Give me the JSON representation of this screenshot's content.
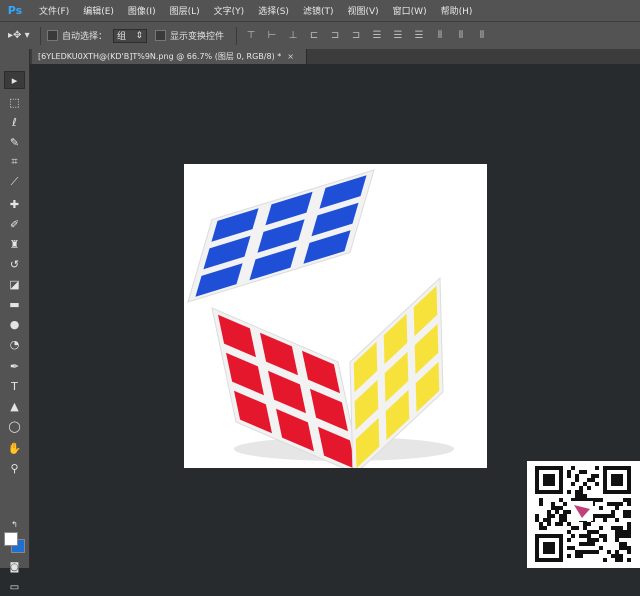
{
  "app": {
    "logo": "Ps"
  },
  "menu": [
    {
      "label": "文件(F)"
    },
    {
      "label": "编辑(E)"
    },
    {
      "label": "图像(I)"
    },
    {
      "label": "图层(L)"
    },
    {
      "label": "文字(Y)"
    },
    {
      "label": "选择(S)"
    },
    {
      "label": "滤镜(T)"
    },
    {
      "label": "视图(V)"
    },
    {
      "label": "窗口(W)"
    },
    {
      "label": "帮助(H)"
    }
  ],
  "options": {
    "auto_select_label": "自动选择：",
    "auto_select_value": "组",
    "show_transform_label": "显示变换控件"
  },
  "document": {
    "tab_title": "[6YLEDKU0XTH@(KD'B]T%9N.png @ 66.7% (图层 0, RGB/8) *",
    "close": "×"
  },
  "tools": [
    {
      "name": "move-tool",
      "glyph": "▸"
    },
    {
      "name": "marquee-tool",
      "glyph": "⬚"
    },
    {
      "name": "lasso-tool",
      "glyph": "ℓ"
    },
    {
      "name": "quick-select-tool",
      "glyph": "✎"
    },
    {
      "name": "crop-tool",
      "glyph": "⌗"
    },
    {
      "name": "eyedropper-tool",
      "glyph": "⟋"
    },
    {
      "name": "healing-tool",
      "glyph": "✚"
    },
    {
      "name": "brush-tool",
      "glyph": "✐"
    },
    {
      "name": "stamp-tool",
      "glyph": "♜"
    },
    {
      "name": "history-brush-tool",
      "glyph": "↺"
    },
    {
      "name": "eraser-tool",
      "glyph": "◪"
    },
    {
      "name": "gradient-tool",
      "glyph": "▬"
    },
    {
      "name": "blur-tool",
      "glyph": "●"
    },
    {
      "name": "dodge-tool",
      "glyph": "◔"
    },
    {
      "name": "pen-tool",
      "glyph": "✒"
    },
    {
      "name": "type-tool",
      "glyph": "T"
    },
    {
      "name": "path-select-tool",
      "glyph": "▲"
    },
    {
      "name": "shape-tool",
      "glyph": "◯"
    },
    {
      "name": "hand-tool",
      "glyph": "✋"
    },
    {
      "name": "zoom-tool",
      "glyph": "⚲"
    }
  ],
  "colors": {
    "blue": "#1f4fd6",
    "red": "#e4172d",
    "yellow": "#f7e23c",
    "body": "#f2f2f2"
  }
}
